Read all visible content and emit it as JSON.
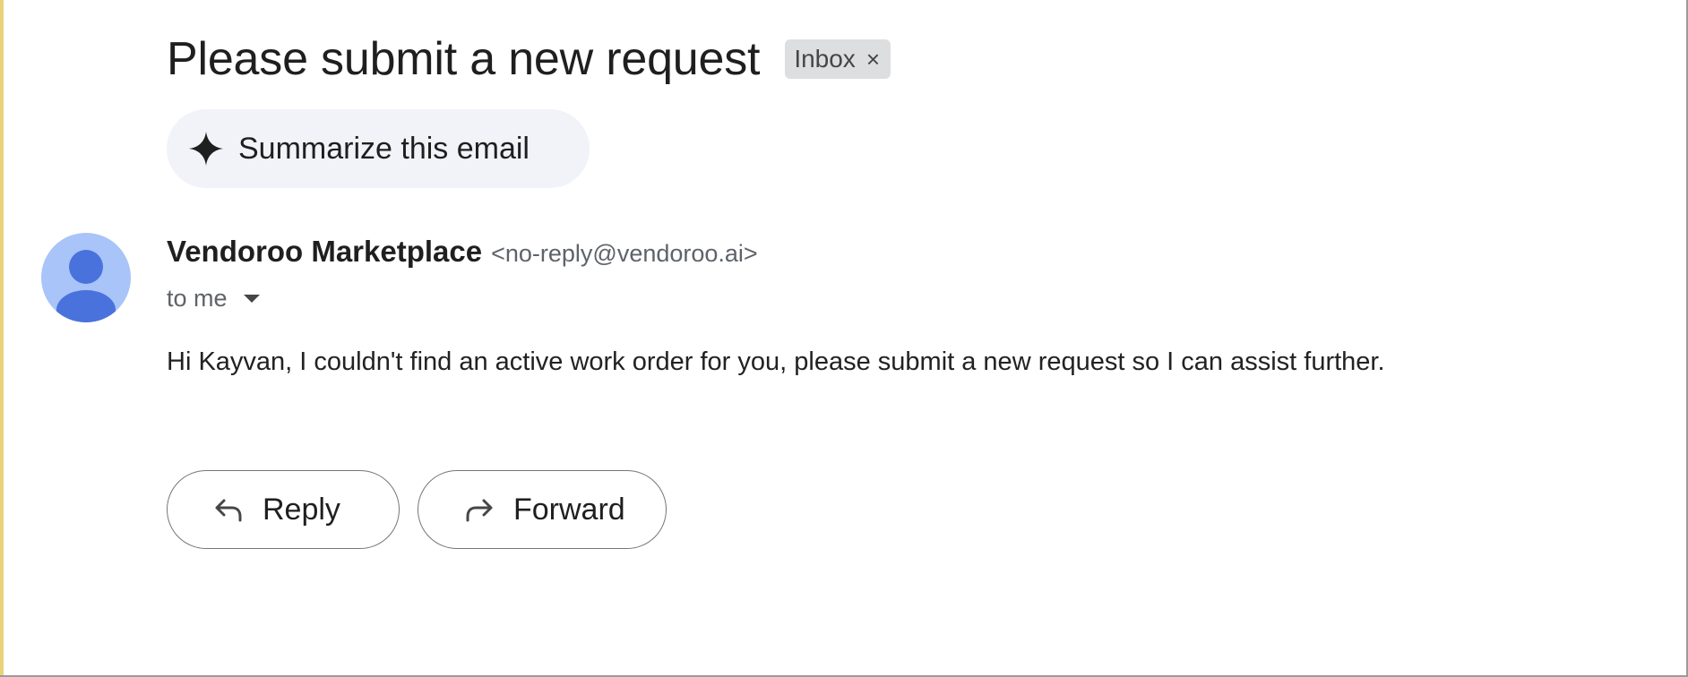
{
  "email": {
    "subject": "Please submit a new request",
    "label": {
      "text": "Inbox",
      "close_glyph": "×"
    },
    "summarize": {
      "icon": "sparkle-icon",
      "label": "Summarize this email"
    },
    "sender": {
      "name": "Vendoroo Marketplace",
      "email": "<no-reply@vendoroo.ai>",
      "avatar_icon": "person-icon"
    },
    "recipient": {
      "text": "to me",
      "icon": "caret-down-icon"
    },
    "body": "Hi Kayvan, I couldn't find an active work order for you, please submit a new request so I can assist further."
  },
  "actions": {
    "reply": {
      "label": "Reply",
      "icon": "reply-icon"
    },
    "forward": {
      "label": "Forward",
      "icon": "forward-icon"
    }
  },
  "colors": {
    "avatar_bg": "#a8c4f8",
    "avatar_fg": "#4a72dc",
    "label_chip_bg": "#dddedf",
    "summarize_bg": "#f1f3f8",
    "button_border": "#747775"
  }
}
